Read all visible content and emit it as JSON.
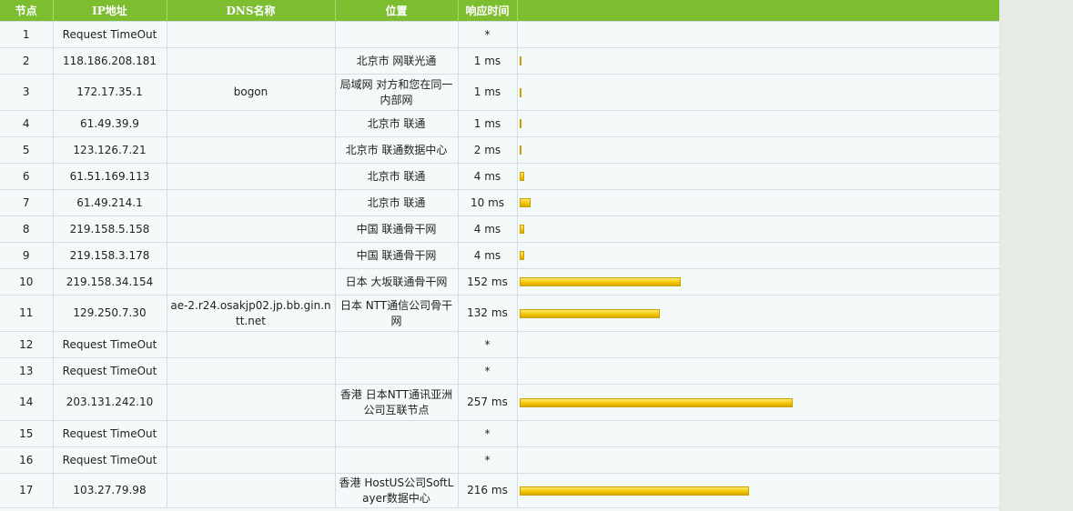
{
  "columns": [
    "节点",
    "IP地址",
    "DNS名称",
    "位置",
    "响应时间",
    ""
  ],
  "rows": [
    {
      "hop": "1",
      "ip": "Request TimeOut",
      "dns": "",
      "location": "",
      "time": "*",
      "ms": 0
    },
    {
      "hop": "2",
      "ip": "118.186.208.181",
      "dns": "",
      "location": "北京市 网联光通",
      "time": "1 ms",
      "ms": 1
    },
    {
      "hop": "3",
      "ip": "172.17.35.1",
      "dns": "bogon",
      "location": "局域网 对方和您在同一内部网",
      "time": "1 ms",
      "ms": 1
    },
    {
      "hop": "4",
      "ip": "61.49.39.9",
      "dns": "",
      "location": "北京市 联通",
      "time": "1 ms",
      "ms": 1
    },
    {
      "hop": "5",
      "ip": "123.126.7.21",
      "dns": "",
      "location": "北京市 联通数据中心",
      "time": "2 ms",
      "ms": 2
    },
    {
      "hop": "6",
      "ip": "61.51.169.113",
      "dns": "",
      "location": "北京市 联通",
      "time": "4 ms",
      "ms": 4
    },
    {
      "hop": "7",
      "ip": "61.49.214.1",
      "dns": "",
      "location": "北京市 联通",
      "time": "10 ms",
      "ms": 10
    },
    {
      "hop": "8",
      "ip": "219.158.5.158",
      "dns": "",
      "location": "中国 联通骨干网",
      "time": "4 ms",
      "ms": 4
    },
    {
      "hop": "9",
      "ip": "219.158.3.178",
      "dns": "",
      "location": "中国 联通骨干网",
      "time": "4 ms",
      "ms": 4
    },
    {
      "hop": "10",
      "ip": "219.158.34.154",
      "dns": "",
      "location": "日本 大坂联通骨干网",
      "time": "152 ms",
      "ms": 152
    },
    {
      "hop": "11",
      "ip": "129.250.7.30",
      "dns": "ae-2.r24.osakjp02.jp.bb.gin.ntt.net",
      "location": "日本 NTT通信公司骨干网",
      "time": "132 ms",
      "ms": 132
    },
    {
      "hop": "12",
      "ip": "Request TimeOut",
      "dns": "",
      "location": "",
      "time": "*",
      "ms": 0
    },
    {
      "hop": "13",
      "ip": "Request TimeOut",
      "dns": "",
      "location": "",
      "time": "*",
      "ms": 0
    },
    {
      "hop": "14",
      "ip": "203.131.242.10",
      "dns": "",
      "location": "香港 日本NTT通讯亚洲公司互联节点",
      "time": "257 ms",
      "ms": 257
    },
    {
      "hop": "15",
      "ip": "Request TimeOut",
      "dns": "",
      "location": "",
      "time": "*",
      "ms": 0
    },
    {
      "hop": "16",
      "ip": "Request TimeOut",
      "dns": "",
      "location": "",
      "time": "*",
      "ms": 0
    },
    {
      "hop": "17",
      "ip": "103.27.79.98",
      "dns": "",
      "location": "香港 HostUS公司SoftLayer数据中心",
      "time": "216 ms",
      "ms": 216
    }
  ]
}
